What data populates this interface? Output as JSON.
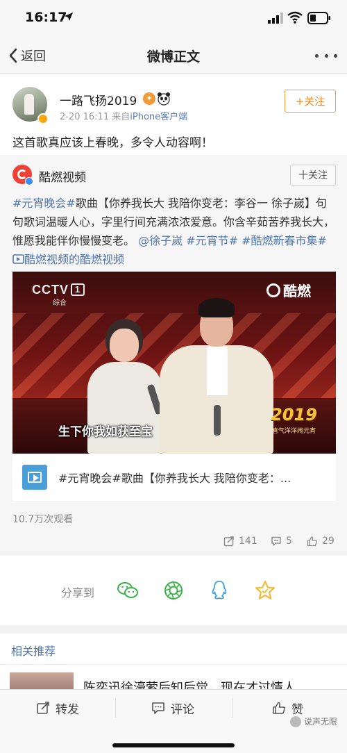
{
  "status": {
    "time": "16:17"
  },
  "nav": {
    "back_label": "返回",
    "title": "微博正文"
  },
  "post": {
    "username": "一路飞扬2019",
    "time": "2-20 16:11",
    "source_prefix": "来自",
    "source": "iPhone客户端",
    "follow_label": "+关注",
    "text": "这首歌真应该上春晚，多令人动容啊！"
  },
  "repost": {
    "author": "酷燃视频",
    "follow_label": "十关注",
    "t1": "#元宵晚会#",
    "t2": "歌曲【你养我长大 我陪你变老：李谷一 徐子嵗】句句歌词温暖人心，字里行间充满浓浓爱意。你含辛茹苦养我长大，惟愿我能伴你慢慢变老。",
    "t3": "@徐子嵗",
    "t4": "#元宵节#",
    "t5": "#酷燃新春市集#",
    "t6": "酷燃视频的酷燃视频",
    "video": {
      "channel": "CCTV",
      "channel_num": "1",
      "channel_sub": "综合",
      "watermark": "酷燃",
      "subtitle": "生下你我如获至宝",
      "event_logo": "2019",
      "event_sub": "喜气洋洋闹元宵"
    },
    "card_text": "#元宵晚会#歌曲【你养我长大 我陪你变老：...",
    "views": "10.7万次观看",
    "reposts": "141",
    "comments": "5",
    "likes": "29"
  },
  "share": {
    "label": "分享到"
  },
  "related": {
    "title": "相关推荐",
    "item_text": "陈奕迅徐濠萦后知后觉，现在才过情人"
  },
  "bottom": {
    "repost": "转发",
    "comment": "评论",
    "like": "赞"
  },
  "watermark": "说声无限"
}
